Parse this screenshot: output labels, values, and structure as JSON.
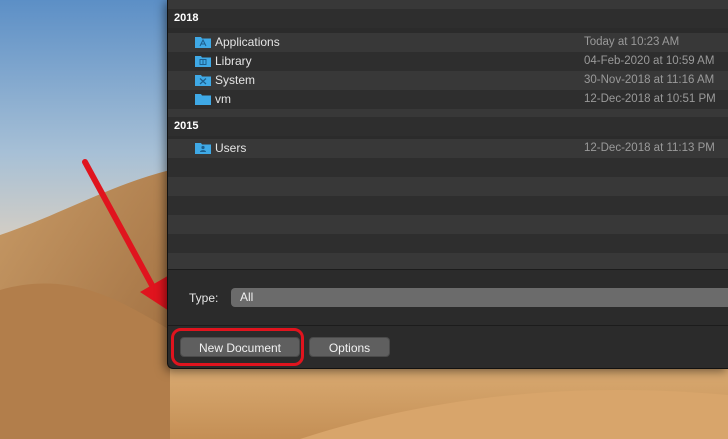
{
  "file_list": {
    "sections": [
      {
        "year": "2018",
        "items": [
          {
            "name": "Applications",
            "date": "Today at 10:23 AM",
            "icon": "applications-folder-icon"
          },
          {
            "name": "Library",
            "date": "04-Feb-2020 at 10:59 AM",
            "icon": "library-folder-icon"
          },
          {
            "name": "System",
            "date": "30-Nov-2018 at 11:16 AM",
            "icon": "system-folder-icon"
          },
          {
            "name": "vm",
            "date": "12-Dec-2018 at 10:51 PM",
            "icon": "folder-icon"
          }
        ]
      },
      {
        "year": "2015",
        "items": [
          {
            "name": "Users",
            "date": "12-Dec-2018 at 11:13 PM",
            "icon": "users-folder-icon"
          }
        ]
      }
    ]
  },
  "type_filter": {
    "label": "Type:",
    "value": "All"
  },
  "buttons": {
    "new_document": "New Document",
    "options": "Options"
  },
  "colors": {
    "annotation_red": "#e0141e",
    "folder_blue": "#3fa9e6",
    "dialog_bg": "#2b2b2b"
  }
}
